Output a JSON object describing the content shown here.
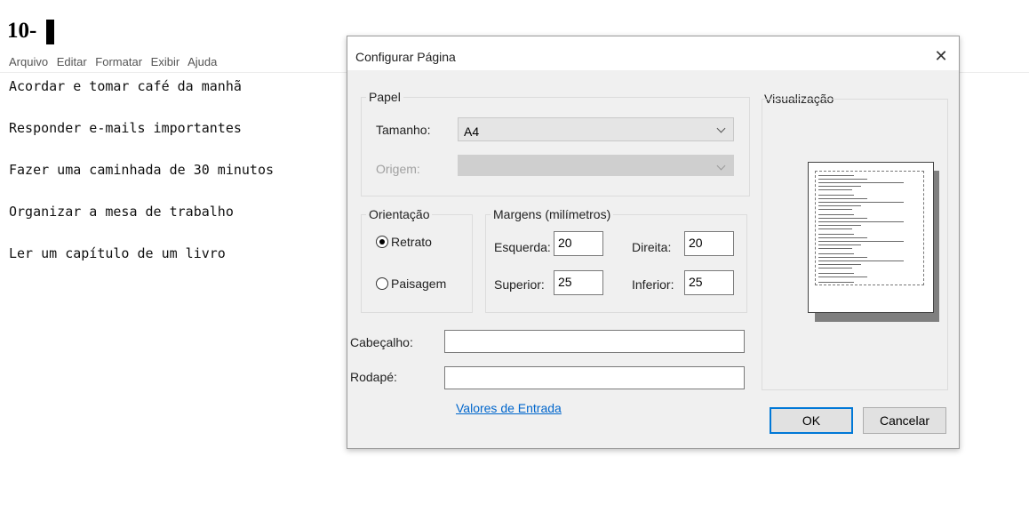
{
  "question": {
    "number": "10-"
  },
  "notepad": {
    "menu": [
      "Arquivo",
      "Editar",
      "Formatar",
      "Exibir",
      "Ajuda"
    ],
    "lines": [
      "Acordar e tomar café da manhã",
      "Responder e-mails importantes",
      "Fazer uma caminhada de 30 minutos",
      "Organizar a mesa de trabalho",
      "Ler um capítulo de um livro"
    ]
  },
  "dialog": {
    "title": "Configurar Página",
    "close_glyph": "✕",
    "paper": {
      "legend": "Papel",
      "size_label": "Tamanho:",
      "size_value": "A4",
      "source_label": "Origem:",
      "source_value": ""
    },
    "orientation": {
      "legend": "Orientação",
      "portrait_label": "Retrato",
      "landscape_label": "Paisagem",
      "selected": "Retrato"
    },
    "margins": {
      "legend": "Margens (milímetros)",
      "left_label": "Esquerda:",
      "left_value": "20",
      "right_label": "Direita:",
      "right_value": "20",
      "top_label": "Superior:",
      "top_value": "25",
      "bottom_label": "Inferior:",
      "bottom_value": "25"
    },
    "header_label": "Cabeçalho:",
    "header_value": "",
    "footer_label": "Rodapé:",
    "footer_value": "",
    "defaults_link": "Valores de Entrada",
    "preview_label": "Visualização",
    "ok_label": "OK",
    "cancel_label": "Cancelar"
  }
}
